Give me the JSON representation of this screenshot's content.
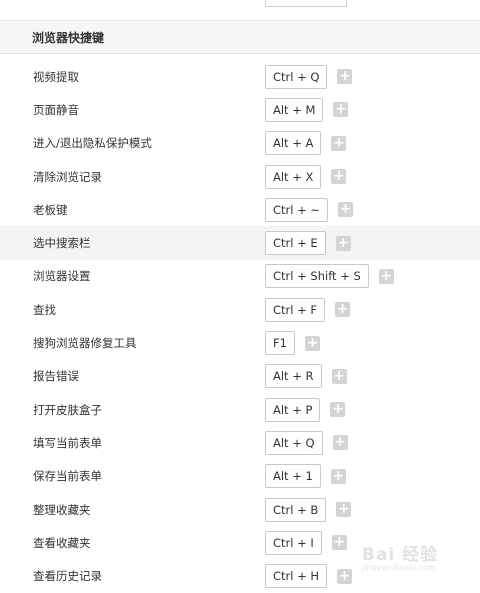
{
  "section": {
    "title": "浏览器快捷键"
  },
  "shortcuts": [
    {
      "label": "视频提取",
      "key": "Ctrl + Q"
    },
    {
      "label": "页面静音",
      "key": "Alt + M"
    },
    {
      "label": "进入/退出隐私保护模式",
      "key": "Alt + A"
    },
    {
      "label": "清除浏览记录",
      "key": "Alt + X"
    },
    {
      "label": "老板键",
      "key": "Ctrl + ~"
    },
    {
      "label": "选中搜索栏",
      "key": "Ctrl + E"
    },
    {
      "label": "浏览器设置",
      "key": "Ctrl + Shift + S"
    },
    {
      "label": "查找",
      "key": "Ctrl + F"
    },
    {
      "label": "搜狗浏览器修复工具",
      "key": "F1"
    },
    {
      "label": "报告错误",
      "key": "Alt + R"
    },
    {
      "label": "打开皮肤盒子",
      "key": "Alt + P"
    },
    {
      "label": "填写当前表单",
      "key": "Alt + Q"
    },
    {
      "label": "保存当前表单",
      "key": "Alt + 1"
    },
    {
      "label": "整理收藏夹",
      "key": "Ctrl + B"
    },
    {
      "label": "查看收藏夹",
      "key": "Ctrl + I"
    },
    {
      "label": "查看历史记录",
      "key": "Ctrl + H"
    }
  ],
  "add_symbol": "+",
  "highlighted_row_index": 5,
  "watermark": {
    "main": "Bai 经验",
    "sub": "jingyan.baidu.com"
  },
  "colors": {
    "header_bg": "#f6f6f6",
    "plus_bg": "#d4d4d4",
    "key_border": "#c8c8c8"
  }
}
